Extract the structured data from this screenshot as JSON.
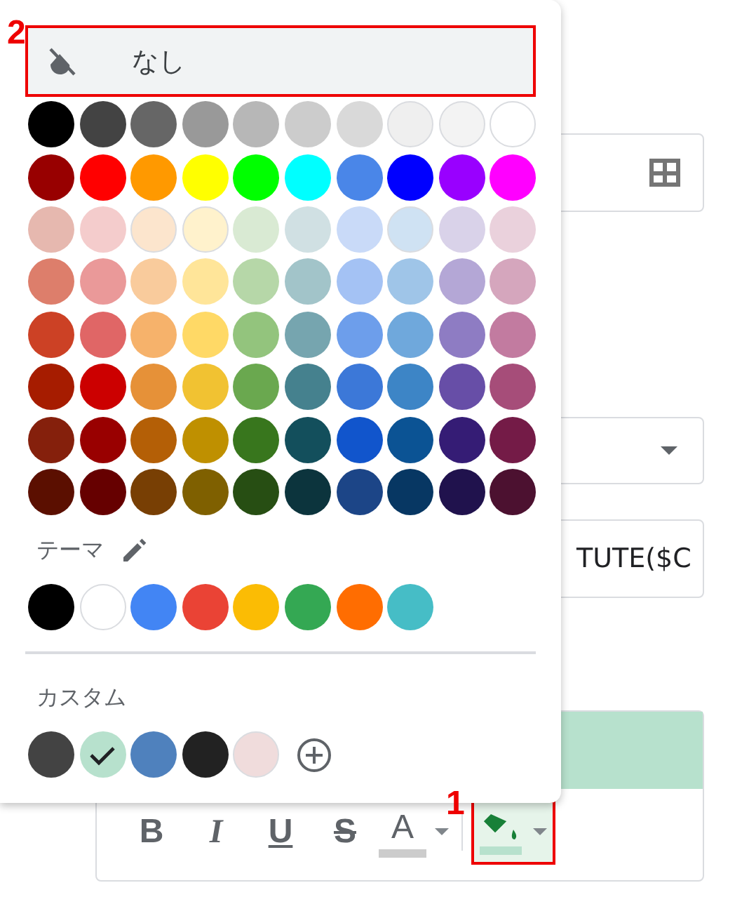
{
  "palette_popup": {
    "none_option": {
      "label": "なし",
      "annotation": "2"
    },
    "palette": [
      [
        {
          "color": "#000000"
        },
        {
          "color": "#434343"
        },
        {
          "color": "#666666"
        },
        {
          "color": "#999999"
        },
        {
          "color": "#b7b7b7"
        },
        {
          "color": "#cccccc"
        },
        {
          "color": "#d9d9d9"
        },
        {
          "color": "#efefef"
        },
        {
          "color": "#f3f3f3"
        },
        {
          "color": "#ffffff"
        }
      ],
      [
        {
          "color": "#980000"
        },
        {
          "color": "#ff0000"
        },
        {
          "color": "#ff9900"
        },
        {
          "color": "#ffff00"
        },
        {
          "color": "#00ff00"
        },
        {
          "color": "#00ffff"
        },
        {
          "color": "#4a86e8"
        },
        {
          "color": "#0000ff"
        },
        {
          "color": "#9900ff"
        },
        {
          "color": "#ff00ff"
        }
      ],
      [
        {
          "color": "#e6b8af"
        },
        {
          "color": "#f4cccc"
        },
        {
          "color": "#fce5cd"
        },
        {
          "color": "#fff2cc"
        },
        {
          "color": "#d9ead3"
        },
        {
          "color": "#d0e0e3"
        },
        {
          "color": "#c9daf8"
        },
        {
          "color": "#cfe2f3"
        },
        {
          "color": "#d9d2e9"
        },
        {
          "color": "#ead1dc"
        }
      ],
      [
        {
          "color": "#dd7e6b"
        },
        {
          "color": "#ea9999"
        },
        {
          "color": "#f9cb9c"
        },
        {
          "color": "#ffe599"
        },
        {
          "color": "#b6d7a8"
        },
        {
          "color": "#a2c4c9"
        },
        {
          "color": "#a4c2f4"
        },
        {
          "color": "#9fc5e8"
        },
        {
          "color": "#b4a7d6"
        },
        {
          "color": "#d5a6bd"
        }
      ],
      [
        {
          "color": "#cc4125"
        },
        {
          "color": "#e06666"
        },
        {
          "color": "#f6b26b"
        },
        {
          "color": "#ffd966"
        },
        {
          "color": "#93c47d"
        },
        {
          "color": "#76a5af"
        },
        {
          "color": "#6d9eeb"
        },
        {
          "color": "#6fa8dc"
        },
        {
          "color": "#8e7cc3"
        },
        {
          "color": "#c27ba0"
        }
      ],
      [
        {
          "color": "#a61c00"
        },
        {
          "color": "#cc0000"
        },
        {
          "color": "#e69138"
        },
        {
          "color": "#f1c232"
        },
        {
          "color": "#6aa84f"
        },
        {
          "color": "#45818e"
        },
        {
          "color": "#3c78d8"
        },
        {
          "color": "#3d85c6"
        },
        {
          "color": "#674ea7"
        },
        {
          "color": "#a64d79"
        }
      ],
      [
        {
          "color": "#85200c"
        },
        {
          "color": "#990000"
        },
        {
          "color": "#b45f06"
        },
        {
          "color": "#bf9000"
        },
        {
          "color": "#38761d"
        },
        {
          "color": "#134f5c"
        },
        {
          "color": "#1155cc"
        },
        {
          "color": "#0b5394"
        },
        {
          "color": "#351c75"
        },
        {
          "color": "#741b47"
        }
      ],
      [
        {
          "color": "#5b0f00"
        },
        {
          "color": "#660000"
        },
        {
          "color": "#783f04"
        },
        {
          "color": "#7f6000"
        },
        {
          "color": "#274e13"
        },
        {
          "color": "#0c343d"
        },
        {
          "color": "#1c4587"
        },
        {
          "color": "#073763"
        },
        {
          "color": "#20124d"
        },
        {
          "color": "#4c1130"
        }
      ]
    ],
    "theme": {
      "label": "テーマ",
      "swatches": [
        {
          "color": "#000000"
        },
        {
          "color": "#ffffff"
        },
        {
          "color": "#4285f4"
        },
        {
          "color": "#ea4335"
        },
        {
          "color": "#fbbc04"
        },
        {
          "color": "#34a853"
        },
        {
          "color": "#ff6d01"
        },
        {
          "color": "#46bdc6"
        }
      ]
    },
    "custom": {
      "label": "カスタム",
      "swatches": [
        {
          "color": "#434343",
          "selected": false
        },
        {
          "color": "#b7e1cd",
          "selected": true
        },
        {
          "color": "#4f81bd",
          "selected": false
        },
        {
          "color": "#222222",
          "selected": false
        },
        {
          "color": "#f0dcdc",
          "selected": false
        }
      ]
    }
  },
  "sidebar": {
    "formula_field": {
      "value": "TUTE($C"
    },
    "preview": {
      "toolbar": [
        {
          "kind": "bold",
          "label": "B",
          "selected": false
        },
        {
          "kind": "italic",
          "label": "I",
          "selected": false
        },
        {
          "kind": "underline",
          "label": "U",
          "selected": false
        },
        {
          "kind": "strike",
          "label": "S",
          "selected": false
        },
        {
          "kind": "text_color",
          "label": "A",
          "color": "#cccccc",
          "selected": false
        },
        {
          "kind": "fill_color",
          "color": "#b7e1cd",
          "selected": true,
          "annotation": "1"
        }
      ]
    }
  }
}
